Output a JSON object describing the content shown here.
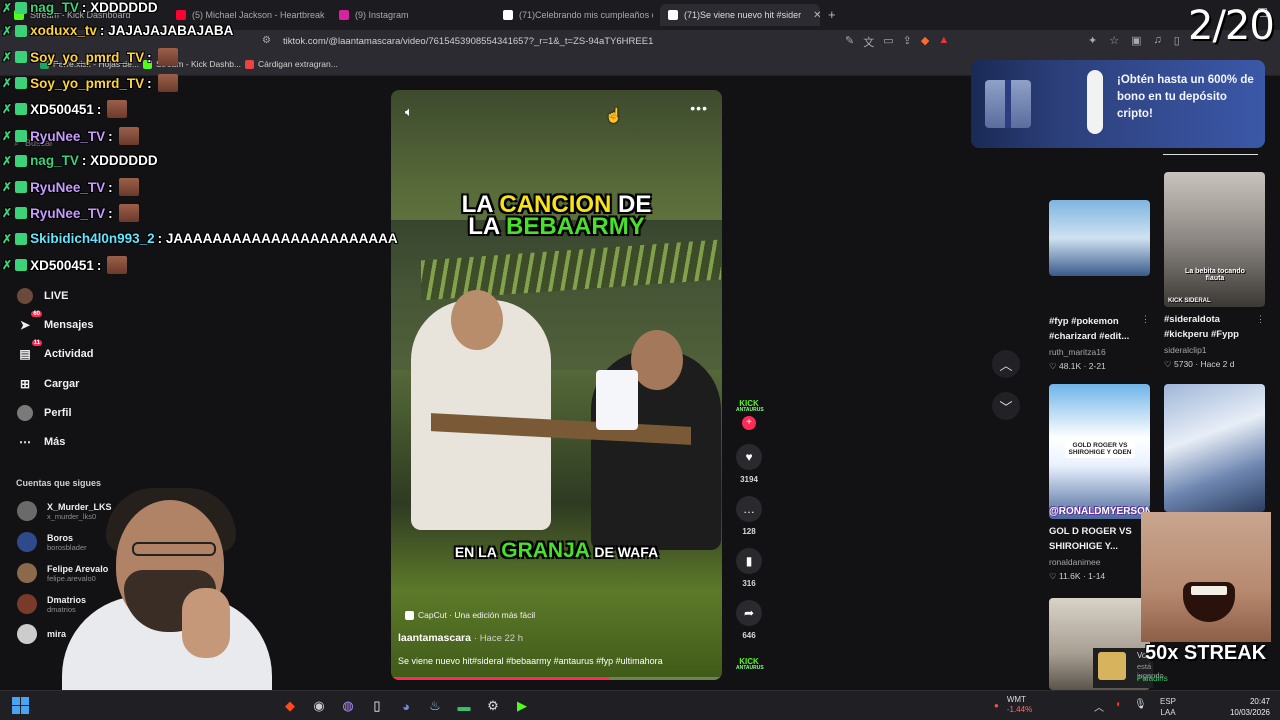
{
  "browser": {
    "tabs": [
      {
        "label": "Stream - Kick Dashboard",
        "color": "#53fc18"
      },
      {
        "label": "(5) Michael Jackson - Heartbreak Hot",
        "color": "#ff0033"
      },
      {
        "label": "(9) Instagram",
        "color": "#d6249f"
      },
      {
        "label": "(71)Celebrando mis cumpleaños en",
        "color": "#ffffff"
      },
      {
        "label": "(71)Se viene nuevo hit #sider",
        "color": "#ffffff",
        "active": true
      }
    ],
    "url": "tiktok.com/@laantamascara/video/7615453908554341657?_r=1&_t=ZS-94aTY6HREE1",
    "bookmarks": [
      {
        "label": "Perre.xlsx - Hojas de...",
        "color": "#1fa463"
      },
      {
        "label": "Stream - Kick Dashb...",
        "color": "#53fc18"
      },
      {
        "label": "Cárdigan extragran...",
        "color": "#e94343"
      }
    ]
  },
  "left_nav": {
    "search_label": "Buscar",
    "items": [
      {
        "label": "LIVE",
        "icon": "live-icon"
      },
      {
        "label": "Mensajes",
        "icon": "messages-icon",
        "badge": "60"
      },
      {
        "label": "Actividad",
        "icon": "activity-icon",
        "badge": "11"
      },
      {
        "label": "Cargar",
        "icon": "upload-icon"
      },
      {
        "label": "Perfil",
        "icon": "profile-icon"
      },
      {
        "label": "Más",
        "icon": "more-icon"
      }
    ],
    "following_title": "Cuentas que sigues",
    "following": [
      {
        "name": "X_Murder_LKS",
        "handle": "x_murder_lks0"
      },
      {
        "name": "Boros",
        "handle": "borosblader"
      },
      {
        "name": "Felipe Arevalo",
        "handle": "felipe.arevalo0"
      },
      {
        "name": "Dmatrios",
        "handle": "dmatrios"
      },
      {
        "name": "mira",
        "handle": ""
      }
    ]
  },
  "video": {
    "caption_top_1a": "LA",
    "caption_top_1b": "CANCION",
    "caption_top_1c": "DE",
    "caption_top_2a": "LA",
    "caption_top_2b": "BEBAARMY",
    "caption_bottom_a": "EN LA",
    "caption_bottom_b": "GRANJA",
    "caption_bottom_c": "DE WAFA",
    "capcut": "CapCut · Una edición más fácil",
    "author": "laantamascara",
    "time": "· Hace 22 h",
    "description": "Se viene nuevo hit#sideral #bebaarmy #antaurus #fyp #ultimahora",
    "progress": 0.66
  },
  "actions": {
    "kick_label": "KICK",
    "kick_sub": "ANTAURUS",
    "likes": "3194",
    "comments": "128",
    "saves": "316",
    "shares": "646"
  },
  "ad": {
    "text": "¡Obtén hasta un 600% de bono en tu depósito cripto!"
  },
  "grid": [
    {
      "caption": "#fyp #pokemon #charizard #edit...",
      "user": "ruth_maritza16",
      "likes": "48.1K",
      "date": "2-21"
    },
    {
      "caption": "#sideraldota #kickperu #Fypp",
      "user": "sideralclip1",
      "likes": "5730",
      "date": "Hace 2 d"
    },
    {
      "caption": "GOL D ROGER VS SHIROHIGE Y...",
      "user": "ronaldanimee",
      "likes": "11.6K",
      "date": "1-14"
    },
    {
      "caption": "",
      "user": "",
      "likes": "",
      "date": ""
    }
  ],
  "grid_thumb_text": {
    "t2": "La bebita tocando flauta",
    "t3a": "GOLD ROGER VS SHIROHIGE Y ODEN",
    "t3b": "@RONALDMYERSON",
    "t2b": "KICK SIDERAL"
  },
  "chat": [
    {
      "user": "nag_TV",
      "msg": ": XDDDDDD",
      "color": "u-green"
    },
    {
      "user": "xoduxx_tv",
      "msg": ": JAJAJAJABAJABA",
      "color": "u-yellow"
    },
    {
      "user": "Soy_yo_pmrd_TV",
      "msg": ":",
      "color": "u-yellow",
      "emote": true
    },
    {
      "user": "Soy_yo_pmrd_TV",
      "msg": ":",
      "color": "u-yellow",
      "emote": true
    },
    {
      "user": "XD500451",
      "msg": ":",
      "color": "u-white",
      "emote": true
    },
    {
      "user": "RyuNee_TV",
      "msg": ":",
      "color": "u-purple",
      "emote": true
    },
    {
      "user": "nag_TV",
      "msg": ": XDDDDDD",
      "color": "u-green"
    },
    {
      "user": "RyuNee_TV",
      "msg": ":",
      "color": "u-purple",
      "emote": true
    },
    {
      "user": "RyuNee_TV",
      "msg": ":",
      "color": "u-purple",
      "emote": true
    },
    {
      "user": "Skibidich4l0n993_2",
      "msg": ": JAAAAAAAAAAAAAAAAAAAAAAA",
      "color": "u-cyan"
    },
    {
      "user": "XD500451",
      "msg": ":",
      "color": "u-white",
      "emote": true
    }
  ],
  "overlay": {
    "counter": "2/20",
    "streak": "50x STREAK"
  },
  "game_notif": {
    "title": "Vo",
    "status": "está jugando",
    "game": "Paladins"
  },
  "taskbar": {
    "stock_name": "WMT",
    "stock_change": "-1.44%",
    "lang_top": "ESP",
    "lang_bottom": "LAA",
    "time": "20:47",
    "date": "10/03/2026"
  }
}
